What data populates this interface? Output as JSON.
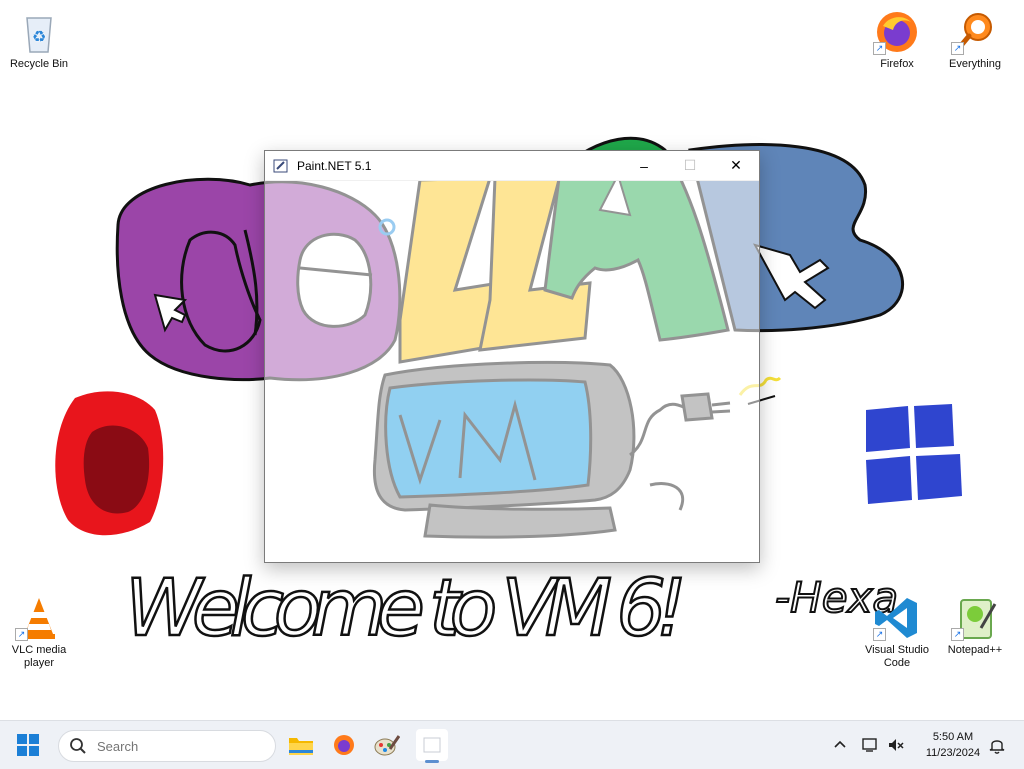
{
  "desktop": {
    "icons": [
      {
        "label": "Recycle Bin"
      },
      {
        "label": "Firefox"
      },
      {
        "label": "Everything"
      },
      {
        "label": "VLC media player"
      },
      {
        "label": "Visual Studio Code"
      },
      {
        "label": "Notepad++"
      }
    ],
    "wallpaper": {
      "drawing_words": [
        "COLLAB",
        "VM"
      ],
      "handwriting": "Welcome to VM 6!",
      "signature": "-Hexa"
    }
  },
  "window": {
    "title": "Paint.NET 5.1",
    "minimize_glyph": "–",
    "maximize_glyph": "☐",
    "close_glyph": "✕"
  },
  "taskbar": {
    "search_placeholder": "Search",
    "pinned_apps": [
      {
        "name": "file-explorer-icon"
      },
      {
        "name": "firefox-icon"
      },
      {
        "name": "paint-net-icon"
      },
      {
        "name": "blank-window-icon",
        "active": true
      }
    ],
    "time": "5:50 AM",
    "date": "11/23/2024"
  },
  "colors": {
    "purple": "#9b45a8",
    "yellow": "#fcc614",
    "green": "#1fa84a",
    "blue": "#5f85b8",
    "screen_blue": "#0d98e0",
    "red": "#e8151c",
    "dark_red": "#8a0b14",
    "windows_blue": "#2f45cf",
    "monitor_gray": "#7a7a7a"
  }
}
